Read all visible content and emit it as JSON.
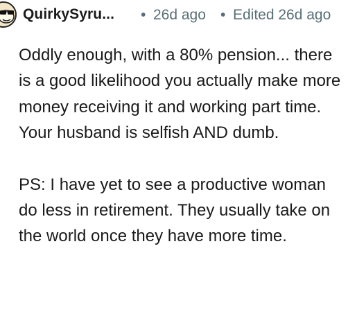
{
  "comment": {
    "author": "QuirkySyru...",
    "separator": "•",
    "posted": "26d ago",
    "edited": "Edited 26d ago",
    "avatar_icon": "snoo-avatar-icon",
    "paragraphs": [
      "Oddly enough, with a 80% pension... there is a good likelihood you actually make more money receiving it and working part time. Your husband is selfish AND dumb.",
      "PS: I have yet to see a productive woman do less in retirement. They usually take on the world once they have more time."
    ]
  },
  "colors": {
    "text": "#1a1a1b",
    "meta": "#576f76",
    "background": "#ffffff"
  }
}
